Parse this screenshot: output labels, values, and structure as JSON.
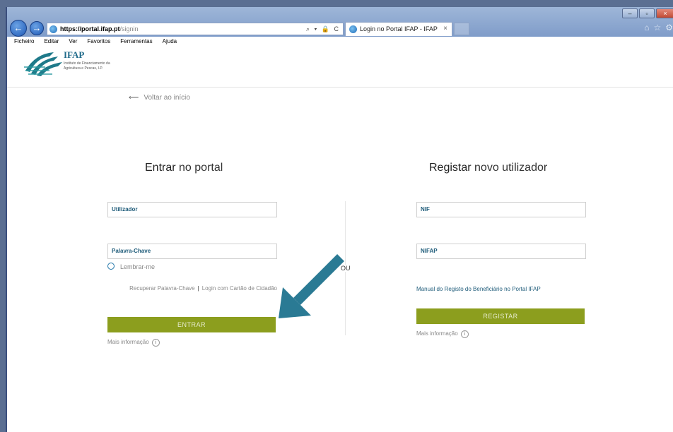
{
  "browser": {
    "address_host": "https://portal.ifap.pt",
    "address_path": "/signin",
    "address_tools": "⌕ ▾ 🔒 C",
    "tab_title": "Login no Portal IFAP - IFAP",
    "tab_close": "×",
    "window_controls": [
      "–",
      "▫",
      "×"
    ],
    "toolbar_icons": [
      "⌂",
      "☆",
      "⚙"
    ]
  },
  "menu": [
    "Ficheiro",
    "Editar",
    "Ver",
    "Favoritos",
    "Ferramentas",
    "Ajuda"
  ],
  "header": {
    "logo_name": "IFAP",
    "logo_subtitle": "Instituto de Financiamento da Agricultura e Pescas, I.P."
  },
  "content": {
    "back_link": "Voltar ao início",
    "back_arrow": "⟵",
    "login": {
      "heading_bold": "Entrar",
      "heading_rest": " no portal",
      "username_placeholder": "Utilizador",
      "password_placeholder": "Palavra-Chave",
      "remember_label": "Lembrar-me",
      "recover_label": "Recuperar Palavra-Chave",
      "separator": "|",
      "citizen_card_label": "Login com Cartão de Cidadão",
      "enter_button": "ENTRAR",
      "more_info": "Mais informação",
      "info_icon": "i"
    },
    "or_label": "OU",
    "register": {
      "heading_bold": "Registar",
      "heading_rest": " novo utilizador",
      "nif_placeholder": "NIF",
      "nifap_placeholder": "NIFAP",
      "manual_link": "Manual do Registo do Beneficiário no Portal IFAP",
      "register_button": "REGISTAR",
      "more_info": "Mais informação",
      "info_icon": "i"
    }
  },
  "colors": {
    "button_green": "#8c9e1e",
    "link_blue": "#1f5c7a",
    "annotation_arrow": "#2a7a94"
  }
}
